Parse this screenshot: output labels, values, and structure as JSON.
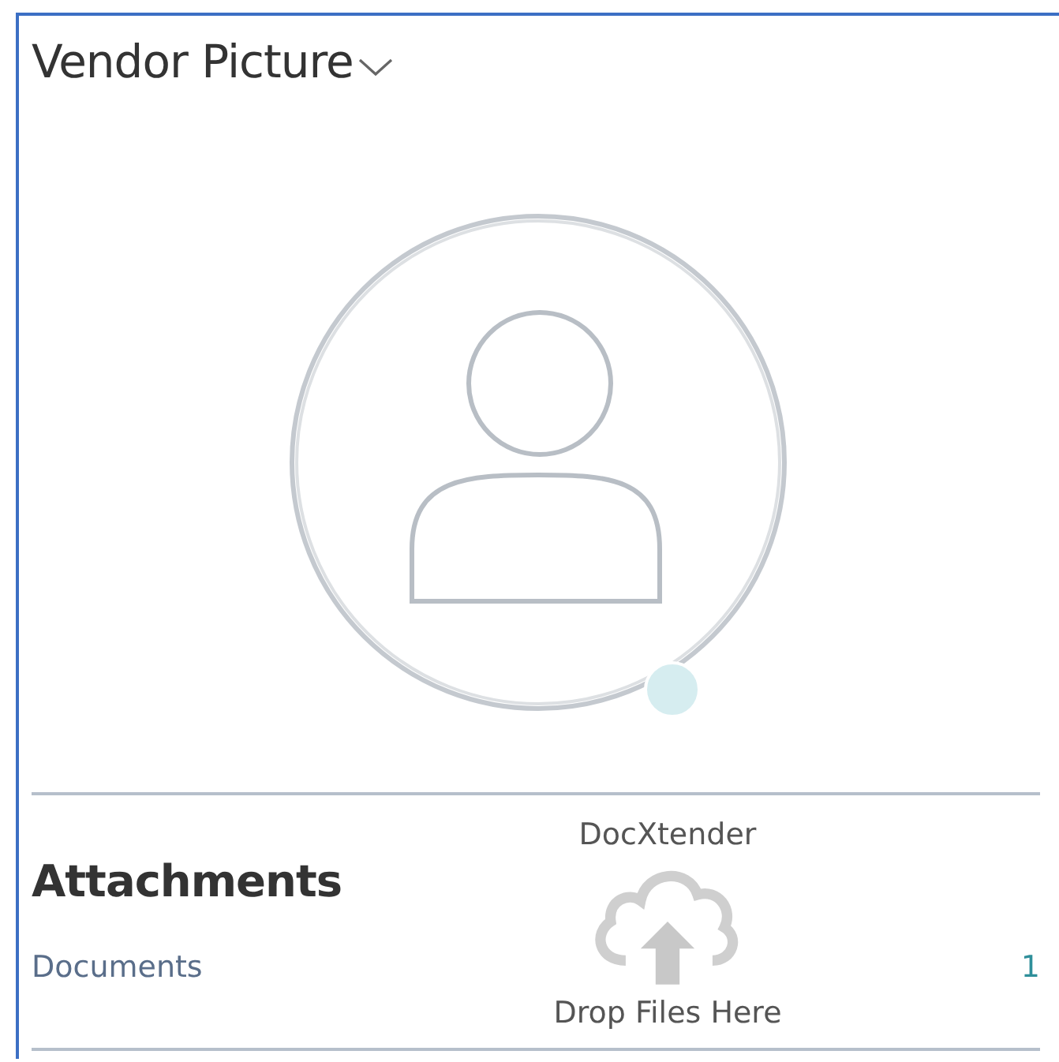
{
  "picture_part": {
    "title": "Vendor Picture"
  },
  "attachments": {
    "title": "Attachments",
    "rows": [
      {
        "label": "Documents",
        "count": "1"
      }
    ],
    "drop_zone": {
      "title": "DocXtender",
      "hint": "Drop Files Here"
    }
  }
}
